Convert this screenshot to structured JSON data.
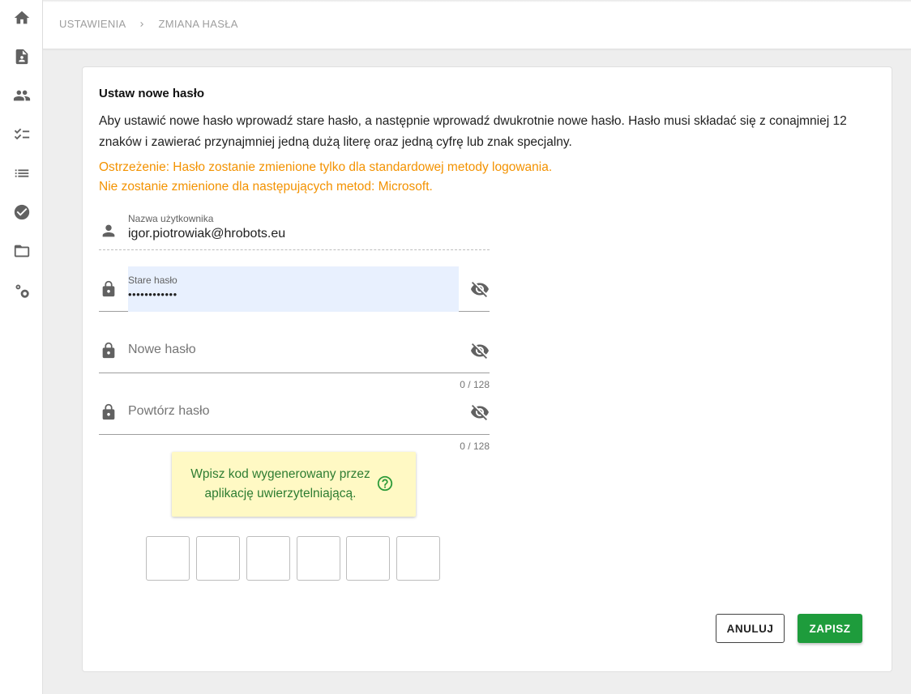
{
  "sidebar": {
    "icons": [
      {
        "name": "home-icon"
      },
      {
        "name": "document-person-icon"
      },
      {
        "name": "people-icon"
      },
      {
        "name": "checklist-icon"
      },
      {
        "name": "list-icon"
      },
      {
        "name": "check-circle-icon"
      },
      {
        "name": "folder-open-icon"
      },
      {
        "name": "settings-gears-icon"
      }
    ]
  },
  "breadcrumb": {
    "items": [
      "USTAWIENIA",
      "ZMIANA HASŁA"
    ]
  },
  "card": {
    "title": "Ustaw nowe hasło",
    "description": "Aby ustawić nowe hasło wprowadź stare hasło, a następnie wprowadź dwukrotnie nowe hasło. Hasło musi składać się z conajmniej 12 znaków i zawierać przynajmniej jedną dużą literę oraz jedną cyfrę lub znak specjalny.",
    "warning_line1": "Ostrzeżenie: Hasło zostanie zmienione tylko dla standardowej metody logowania.",
    "warning_line2": "Nie zostanie zmienione dla następujących metod: Microsoft.",
    "warning_color": "#f39200"
  },
  "form": {
    "username": {
      "label": "Nazwa użytkownika",
      "value": "igor.piotrowiak@hrobots.eu"
    },
    "old_password": {
      "label": "Stare hasło",
      "value": "••••••••••••"
    },
    "new_password": {
      "placeholder": "Nowe hasło",
      "counter": "0 / 128"
    },
    "repeat_password": {
      "placeholder": "Powtórz hasło",
      "counter": "0 / 128"
    }
  },
  "twofa": {
    "info_text": "Wpisz kod wygenerowany przez aplikację uwierzytelniającą.",
    "code_boxes": 6
  },
  "actions": {
    "cancel_label": "ANULUJ",
    "save_label": "ZAPISZ",
    "save_color": "#1e9c3c"
  }
}
